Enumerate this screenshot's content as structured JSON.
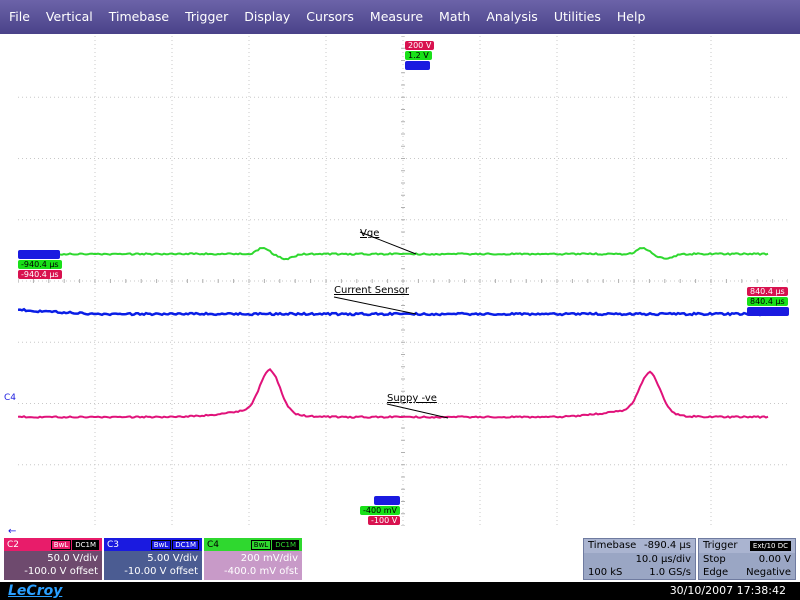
{
  "menu": [
    "File",
    "Vertical",
    "Timebase",
    "Trigger",
    "Display",
    "Cursors",
    "Measure",
    "Math",
    "Analysis",
    "Utilities",
    "Help"
  ],
  "top_markers": {
    "red": "200 V",
    "green": "1.2 V",
    "blue": ""
  },
  "bottom_markers": {
    "blue": "",
    "green": "-400 mV",
    "red": "-100 V"
  },
  "left_markers": {
    "blue": "",
    "green": "-940.4 µs",
    "red": "-940.4 µs"
  },
  "right_markers": {
    "red": "840.4 µs",
    "green": "840.4 µs",
    "blue": ""
  },
  "trace_labels": {
    "vge": "Vge",
    "current": "Current Sensor",
    "supply": "Suppy -ve"
  },
  "c4_marker": "C4",
  "channels": [
    {
      "name": "C2",
      "badges": [
        "BwL",
        "DC1M"
      ],
      "vdiv": "50.0 V/div",
      "offset": "-100.0 V offset",
      "color": "#e81c6a"
    },
    {
      "name": "C3",
      "badges": [
        "BwL",
        "DC1M"
      ],
      "vdiv": "5.00 V/div",
      "offset": "-10.00 V offset",
      "color": "#1a1ae0"
    },
    {
      "name": "C4",
      "badges": [
        "BwL",
        "DC1M"
      ],
      "vdiv": "200 mV/div",
      "offset": "-400.0 mV ofst",
      "color": "#19c019"
    }
  ],
  "timebase": {
    "label": "Timebase",
    "delay": "-890.4 µs",
    "tdiv": "10.0 µs/div",
    "samples": "100 kS",
    "rate": "1.0 GS/s"
  },
  "trigger": {
    "label": "Trigger",
    "badge": "Ext/10 DC",
    "mode": "Stop",
    "level": "0.00 V",
    "type": "Edge",
    "slope": "Negative"
  },
  "brand": "LeCroy",
  "datetime": "30/10/2007 17:38:42",
  "colors": {
    "menubar": "#5a52a0",
    "grid_bg": "#ffffff",
    "grid_line": "#c8c8c8",
    "vge": "#2fd82f",
    "current": "#0a1ee6",
    "supply": "#e0127a"
  }
}
